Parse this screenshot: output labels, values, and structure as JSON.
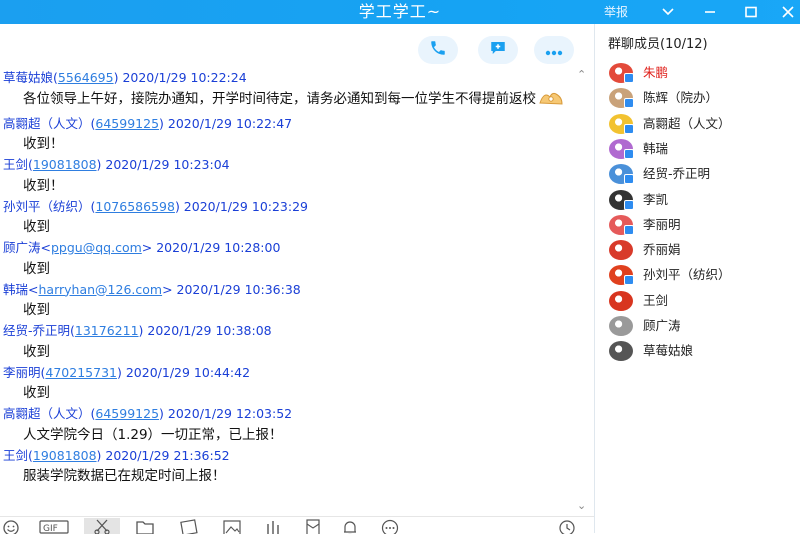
{
  "window": {
    "title": "学工学工~",
    "report_label": "举报"
  },
  "chat": {
    "messages": [
      {
        "sender": "草莓姑娘",
        "contact": "5564695",
        "time": "2020/1/29 10:22:24",
        "text": "各位领导上午好，接院办通知，开学时间待定，请务必通知到每一位学生不得提前返校",
        "emoji": "ok-hand"
      },
      {
        "sender": "高翾超（人文）",
        "contact": "64599125",
        "time": "2020/1/29 10:22:47",
        "text": "收到！"
      },
      {
        "sender": "王剑",
        "contact": "19081808",
        "time": "2020/1/29 10:23:04",
        "text": "收到！"
      },
      {
        "sender": "孙刘平（纺织）",
        "contact": "1076586598",
        "time": "2020/1/29 10:23:29",
        "text": "收到"
      },
      {
        "sender": "顾广涛",
        "contact": "ppgu@qq.com",
        "time": "2020/1/29 10:28:00",
        "text": "收到"
      },
      {
        "sender": "韩瑞",
        "contact": "harryhan@126.com",
        "time": "2020/1/29 10:36:38",
        "text": "收到"
      },
      {
        "sender": "经贸-乔正明",
        "contact": "13176211",
        "time": "2020/1/29 10:38:08",
        "text": "收到"
      },
      {
        "sender": "李丽明",
        "contact": "470215731",
        "time": "2020/1/29 10:44:42",
        "text": "收到"
      },
      {
        "sender": "高翾超（人文）",
        "contact": "64599125",
        "time": "2020/1/29 12:03:52",
        "text": "人文学院今日（1.29）一切正常，已上报！"
      },
      {
        "sender": "王剑",
        "contact": "19081808",
        "time": "2020/1/29 21:36:52",
        "text": "服装学院数据已在规定时间上报！"
      }
    ]
  },
  "members": {
    "title": "群聊成员(10/12)",
    "items": [
      {
        "name": "朱鹏",
        "owner": true,
        "color": "#e34a3a",
        "admin": true
      },
      {
        "name": "陈辉（院办）",
        "owner": false,
        "color": "#c9a27a",
        "admin": true
      },
      {
        "name": "高翾超（人文）",
        "owner": false,
        "color": "#f2c230",
        "admin": true
      },
      {
        "name": "韩瑞",
        "owner": false,
        "color": "#b06ad0",
        "admin": true
      },
      {
        "name": "经贸-乔正明",
        "owner": false,
        "color": "#4a90d9",
        "admin": true
      },
      {
        "name": "李凯",
        "owner": false,
        "color": "#333333",
        "admin": true
      },
      {
        "name": "李丽明",
        "owner": false,
        "color": "#e55a5a",
        "admin": true
      },
      {
        "name": "乔丽娟",
        "owner": false,
        "color": "#d83a2a",
        "admin": false
      },
      {
        "name": "孙刘平（纺织）",
        "owner": false,
        "color": "#e0401e",
        "admin": true
      },
      {
        "name": "王剑",
        "owner": false,
        "color": "#d8351f",
        "admin": false
      },
      {
        "name": "顾广涛",
        "owner": false,
        "color": "#9a9a9a",
        "admin": false
      },
      {
        "name": "草莓姑娘",
        "owner": false,
        "color": "#555555",
        "admin": false
      }
    ]
  },
  "icons": {
    "phone": "phone-icon",
    "share_screen": "screen-share-icon",
    "more": "more-icon",
    "toolbar": [
      "emoji-icon",
      "gif-icon",
      "scissors-icon",
      "folder-icon",
      "image-search-icon",
      "image-icon",
      "voice-bars-icon",
      "red-packet-icon",
      "bell-icon",
      "more-chat-icon",
      "history-icon"
    ]
  },
  "colors": {
    "titlebar": "#1b9ff0",
    "sender": "#1a3fd6",
    "link": "#2f7ee0",
    "owner_name": "#e0201b",
    "action_button_bg": "#e9f4fd",
    "action_icon": "#1aa0f0"
  }
}
